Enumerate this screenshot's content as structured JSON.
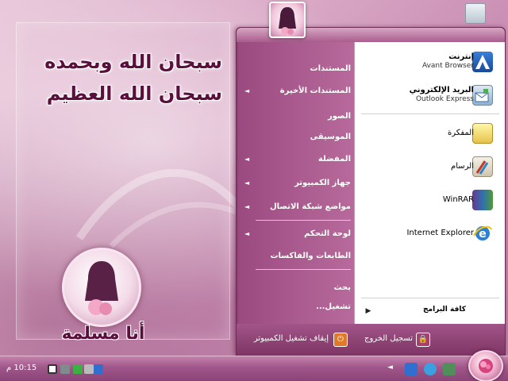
{
  "desktop": {
    "phrase_1": "سبحان الله وبحمده",
    "phrase_2": "سبحان الله العظيم",
    "tag": "أنا مسلمة"
  },
  "start_menu": {
    "places": [
      {
        "label": "المستندات",
        "arrow": ""
      },
      {
        "label": "المستندات الأخيرة",
        "arrow": "◄"
      },
      {
        "label": "الصور",
        "arrow": ""
      },
      {
        "label": "الموسيقى",
        "arrow": ""
      },
      {
        "label": "المفضلة",
        "arrow": "◄"
      },
      {
        "label": "جهاز الكمبيوتر",
        "arrow": "◄"
      },
      {
        "label": "مواضع شبكة الاتصال",
        "arrow": "◄"
      },
      {
        "label": "لوحة التحكم",
        "arrow": "◄"
      },
      {
        "label": "الطابعات والفاكسات",
        "arrow": ""
      },
      {
        "label": "بحث",
        "arrow": ""
      },
      {
        "label": "تشغيل...",
        "arrow": ""
      }
    ],
    "pinned": [
      {
        "title": "إنترنت",
        "subtitle": "Avant Browser",
        "icon": "avant-browser-icon"
      },
      {
        "title": "البريد الإلكتروني",
        "subtitle": "Outlook Express",
        "icon": "outlook-express-icon"
      }
    ],
    "recent": [
      {
        "title": "المفكرة",
        "icon": "notepad-icon"
      },
      {
        "title": "الرسام",
        "icon": "paint-icon"
      },
      {
        "title": "WinRAR",
        "icon": "winrar-icon"
      },
      {
        "title": "Internet Explorer",
        "icon": "internet-explorer-icon"
      }
    ],
    "all_programs": "كافة البرامج",
    "all_programs_arrow": "▶",
    "logoff_label": "تسجيل الخروج",
    "shutdown_label": "إيقاف تشغيل الكمبيوتر",
    "logoff_glyph": "🔒",
    "shutdown_glyph": "⏻"
  },
  "taskbar": {
    "clock": "10:15 م",
    "tray_chevron": "◄"
  },
  "colors": {
    "menu_purple": "#8c3f71",
    "accent_pink": "#c483ad",
    "text_dark": "#5b0f3d"
  }
}
